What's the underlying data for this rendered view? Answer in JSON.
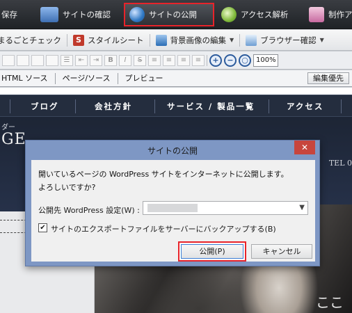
{
  "ribbon": {
    "items": [
      {
        "label": "保存",
        "color": "#4a8f3a"
      },
      {
        "label": "サイトの確認",
        "color": "#4a7fc8"
      },
      {
        "label": "サイトの公開",
        "color": "#2f78c4"
      },
      {
        "label": "アクセス解析",
        "color": "#7fb83a"
      },
      {
        "label": "制作ア",
        "color": "#c86aa0"
      }
    ]
  },
  "toolbar2": {
    "items": [
      {
        "label": "まるごとチェック"
      },
      {
        "label": "スタイルシート"
      },
      {
        "label": "背景画像の編集"
      },
      {
        "label": "ブラウザー確認"
      }
    ]
  },
  "toolbar3": {
    "zoom": "100%"
  },
  "view_tabs": [
    "HTML ソース",
    "ページ/ソース",
    "プレビュー"
  ],
  "edit_priority": "編集優先",
  "site": {
    "nav": [
      "ブログ",
      "会社方針",
      "サービス / 製品一覧",
      "アクセス"
    ],
    "tag_fragment": "ダー",
    "title_fragment": "GE",
    "tel_fragment": "TEL 0",
    "photo_text": "ここ"
  },
  "dialog": {
    "title": "サイトの公開",
    "close": "✕",
    "message_line1": "開いているページの WordPress サイトをインターネットに公開します。",
    "message_line2": "よろしいですか?",
    "dest_label": "公開先 WordPress 設定(W) :",
    "backup_label": "サイトのエクスポートファイルをサーバーにバックアップする(B)",
    "backup_checked": "✔",
    "publish_button": "公開(P)",
    "cancel_button": "キャンセル"
  }
}
